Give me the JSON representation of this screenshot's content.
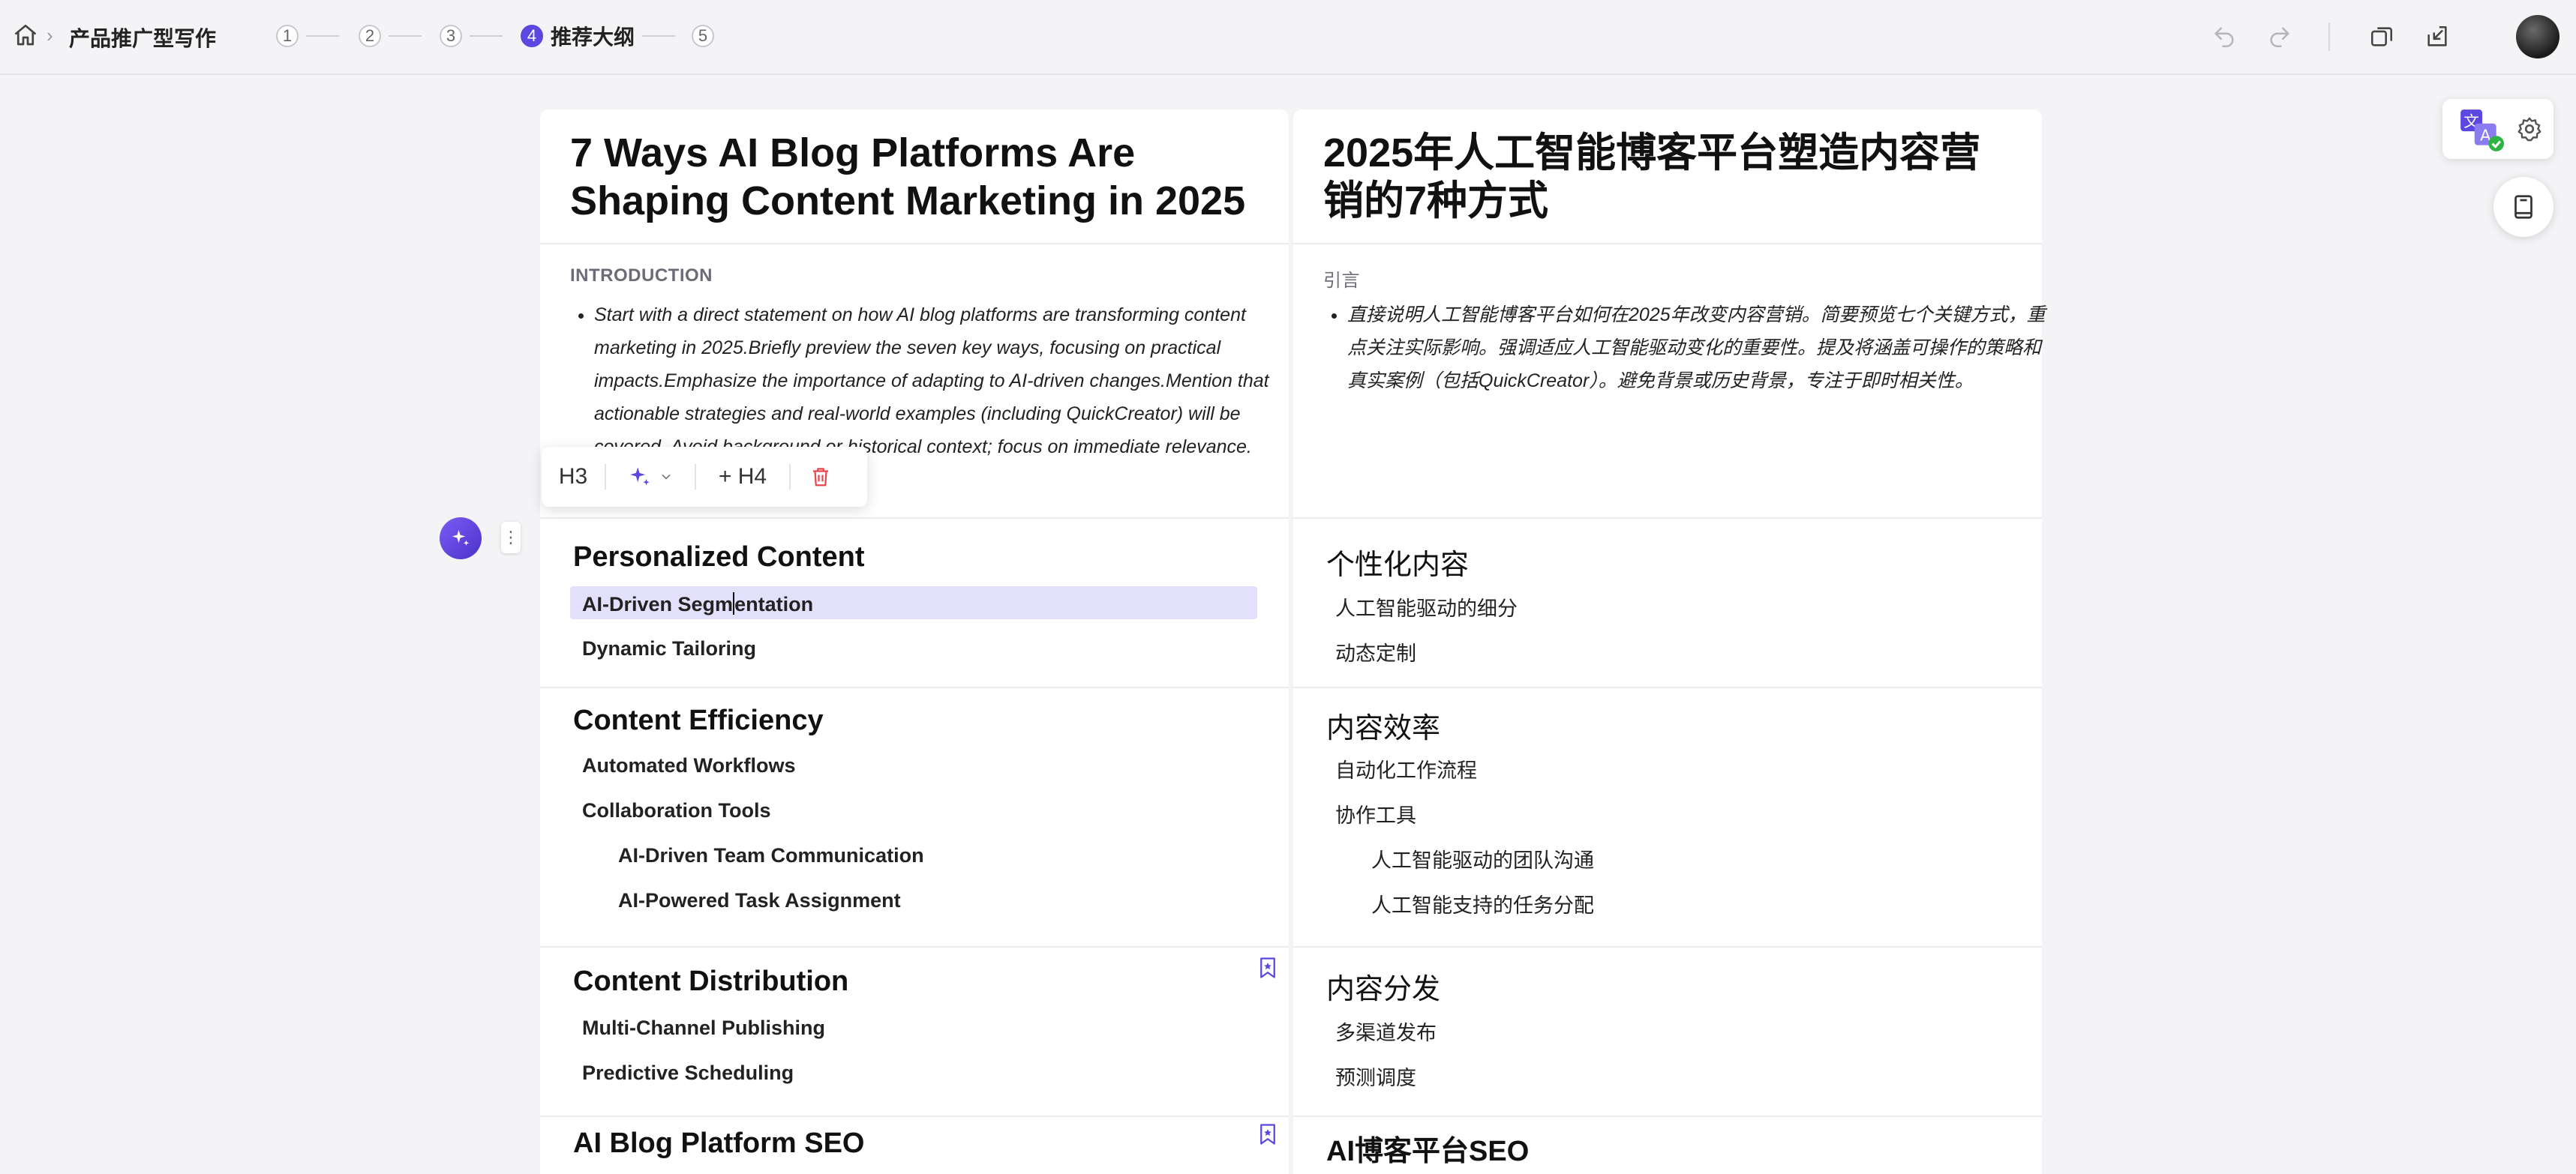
{
  "topbar": {
    "title": "产品推广型写作",
    "steps": [
      {
        "num": "1",
        "label": ""
      },
      {
        "num": "2",
        "label": ""
      },
      {
        "num": "3",
        "label": ""
      },
      {
        "num": "4",
        "label": "推荐大纲",
        "active": true
      },
      {
        "num": "5",
        "label": ""
      }
    ],
    "icons": [
      "home-icon",
      "undo-icon",
      "redo-icon",
      "duplicate-icon",
      "export-icon"
    ]
  },
  "left": {
    "title": "7 Ways AI Blog Platforms Are Shaping Content Marketing in 2025",
    "intro_label": "INTRODUCTION",
    "intro_text": "Start with a direct statement on how AI blog platforms are transforming content marketing in 2025.Briefly preview the seven key ways, focusing on practical impacts.Emphasize the importance of adapting to AI-driven changes.Mention that actionable strategies and real-world examples (including QuickCreator) will be covered. Avoid background or historical context; focus on immediate relevance.",
    "sections": [
      {
        "h3": "Personalized Content",
        "h4": [
          "AI-Driven Segmentation",
          "Dynamic Tailoring"
        ]
      },
      {
        "h3": "Content Efficiency",
        "h4": [
          "Automated Workflows",
          "Collaboration Tools"
        ],
        "h5": [
          "AI-Driven Team Communication",
          "AI-Powered Task Assignment"
        ]
      },
      {
        "h3": "Content Distribution",
        "h4": [
          "Multi-Channel Publishing",
          "Predictive Scheduling"
        ]
      },
      {
        "h3": "AI Blog Platform SEO"
      }
    ]
  },
  "right": {
    "title": "2025年人工智能博客平台塑造内容营销的7种方式",
    "intro_label": "引言",
    "intro_text": "直接说明人工智能博客平台如何在2025年改变内容营销。简要预览七个关键方式，重点关注实际影响。强调适应人工智能驱动变化的重要性。提及将涵盖可操作的策略和真实案例（包括QuickCreator）。避免背景或历史背景，专注于即时相关性。",
    "sections": [
      {
        "h3": "个性化内容",
        "h4": [
          "人工智能驱动的细分",
          "动态定制"
        ]
      },
      {
        "h3": "内容效率",
        "h4": [
          "自动化工作流程",
          "协作工具"
        ],
        "h5": [
          "人工智能驱动的团队沟通",
          "人工智能支持的任务分配"
        ]
      },
      {
        "h3": "内容分发",
        "h4": [
          "多渠道发布",
          "预测调度"
        ]
      },
      {
        "h3": "AI博客平台SEO"
      }
    ]
  },
  "toolbar": {
    "heading_label": "H3",
    "add_label": "+ H4"
  },
  "colors": {
    "accent": "#5b48e0",
    "highlight": "#e3e0fb",
    "delete": "#e5484d"
  }
}
